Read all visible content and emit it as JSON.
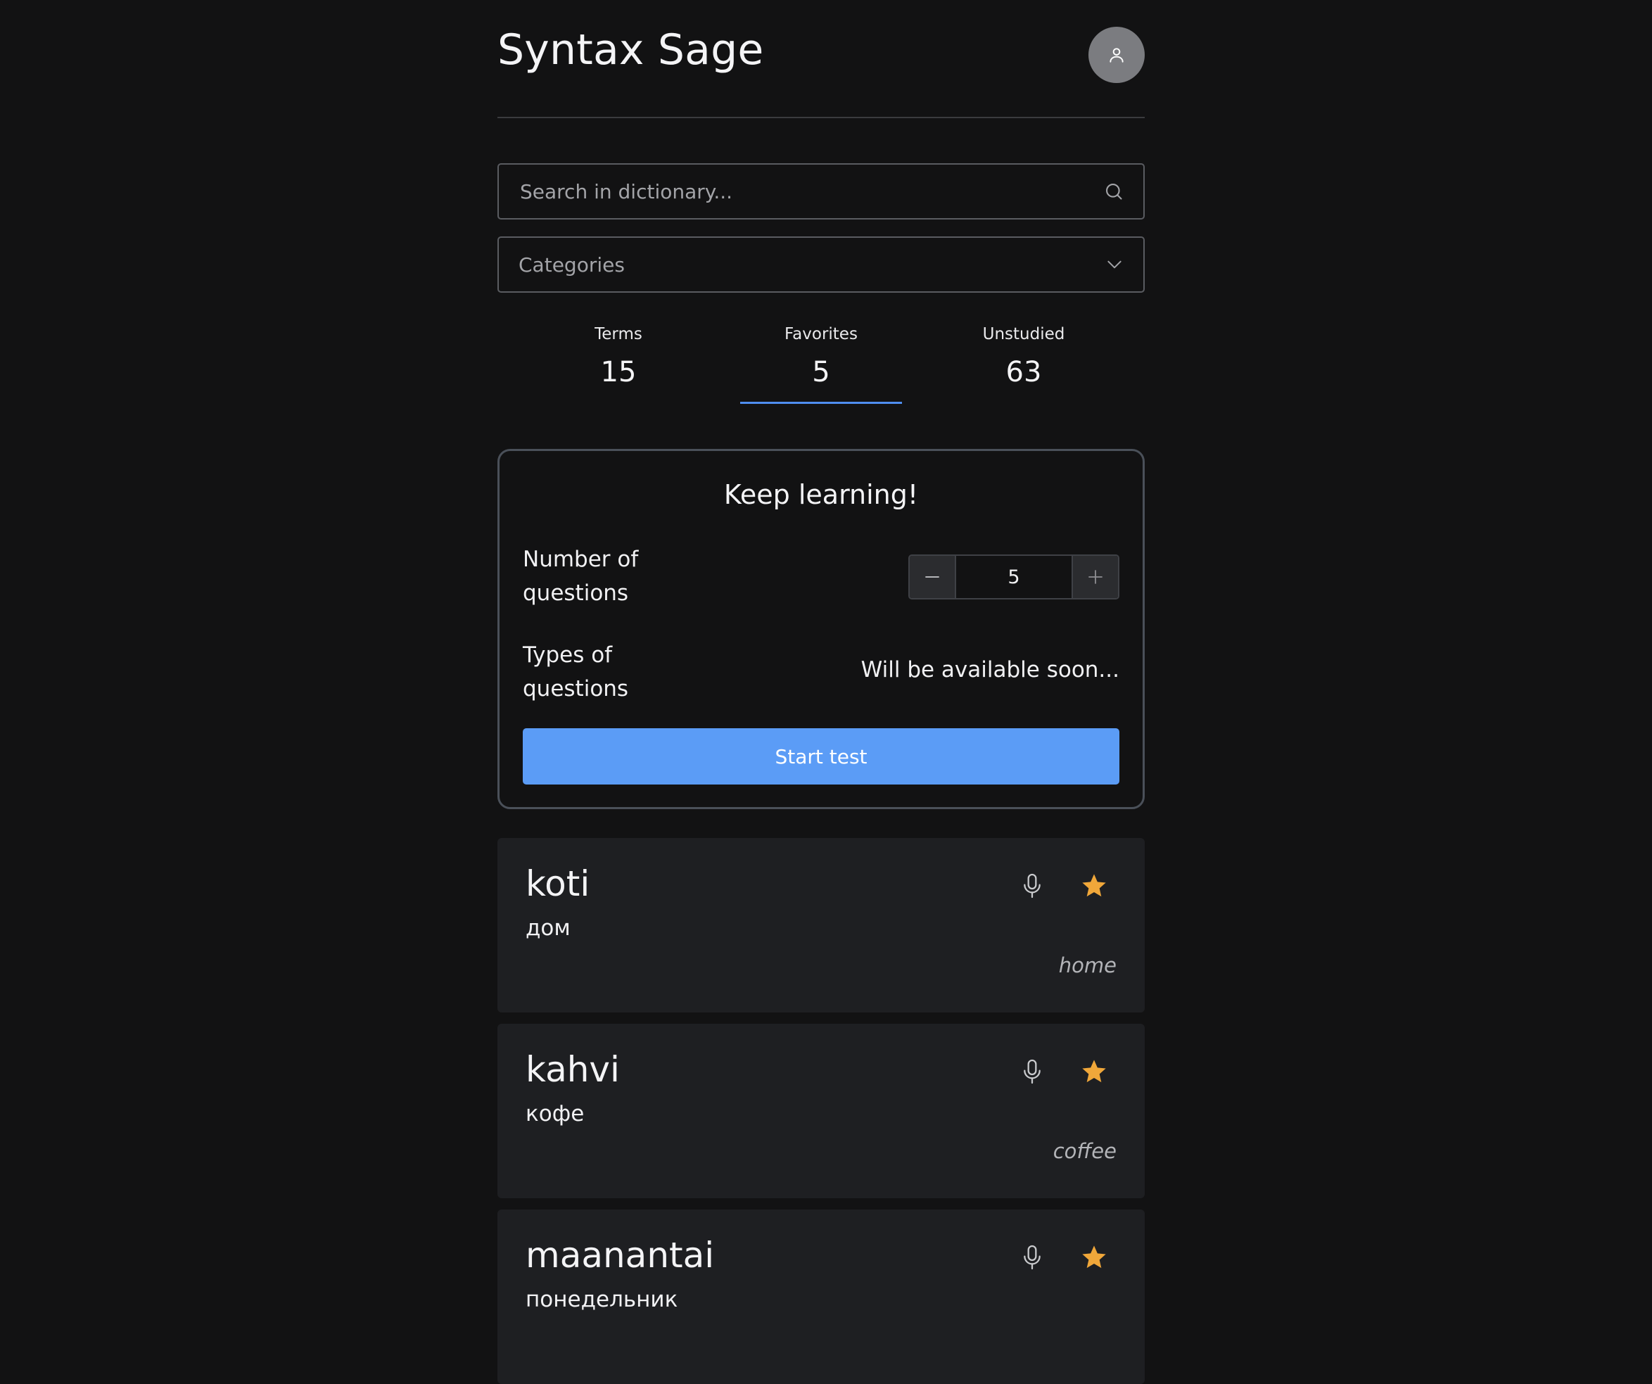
{
  "app": {
    "title": "Syntax Sage"
  },
  "search": {
    "placeholder": "Search in dictionary...",
    "value": ""
  },
  "categories": {
    "label": "Categories"
  },
  "stats": [
    {
      "label": "Terms",
      "value": "15"
    },
    {
      "label": "Favorites",
      "value": "5"
    },
    {
      "label": "Unstudied",
      "value": "63"
    }
  ],
  "active_stat": "Favorites",
  "test_card": {
    "title": "Keep learning!",
    "num_questions_label": "Number of questions",
    "num_questions_value": "5",
    "types_label": "Types of questions",
    "types_value": "Will be available soon...",
    "start_label": "Start test"
  },
  "words": [
    {
      "term": "koti",
      "translation": "дом",
      "english": "home",
      "favorite": true
    },
    {
      "term": "kahvi",
      "translation": "кофе",
      "english": "coffee",
      "favorite": true
    },
    {
      "term": "maanantai",
      "translation": "понедельник",
      "english": "",
      "favorite": true
    }
  ],
  "colors": {
    "background": "#121213",
    "accent": "#5b9cf6",
    "tab_underline": "#4f8ef0",
    "star": "#f0a73a",
    "card": "#1e1f22"
  },
  "icons": {
    "avatar": "user-icon",
    "search": "search-icon",
    "dropdown": "chevron-down-icon",
    "decrement": "minus-icon",
    "increment": "plus-icon",
    "pronounce": "microphone-icon",
    "favorite": "star-icon"
  }
}
